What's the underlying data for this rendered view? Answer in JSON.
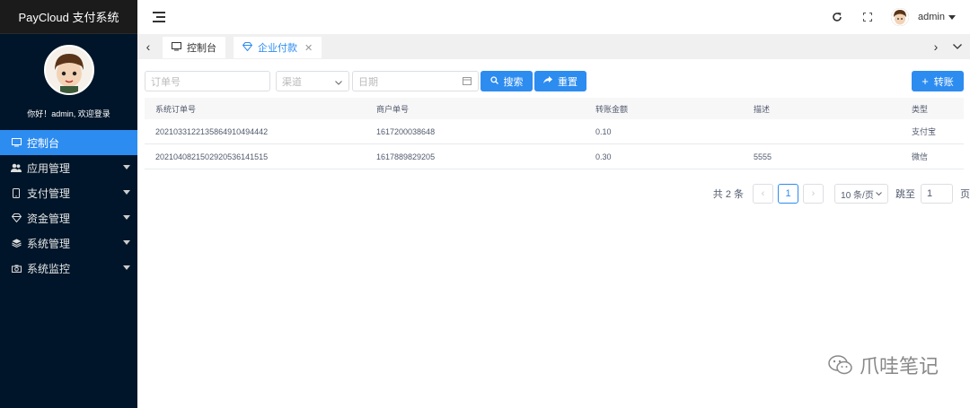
{
  "app": {
    "brand": "PayCloud 支付系统",
    "welcome": "你好！admin, 欢迎登录"
  },
  "sidebar": {
    "items": [
      {
        "label": "控制台",
        "icon": "monitor-icon",
        "active": true,
        "has_caret": false
      },
      {
        "label": "应用管理",
        "icon": "users-icon",
        "active": false,
        "has_caret": true
      },
      {
        "label": "支付管理",
        "icon": "mobile-icon",
        "active": false,
        "has_caret": true
      },
      {
        "label": "资金管理",
        "icon": "diamond-icon",
        "active": false,
        "has_caret": true
      },
      {
        "label": "系统管理",
        "icon": "layers-icon",
        "active": false,
        "has_caret": true
      },
      {
        "label": "系统监控",
        "icon": "camera-icon",
        "active": false,
        "has_caret": true
      }
    ]
  },
  "header": {
    "username": "admin"
  },
  "tabs": [
    {
      "label": "控制台",
      "icon": "monitor-icon",
      "active": false,
      "closable": false
    },
    {
      "label": "企业付款",
      "icon": "diamond-icon",
      "active": true,
      "closable": true
    }
  ],
  "search": {
    "order_no_placeholder": "订单号",
    "channel_placeholder": "渠道",
    "date_placeholder": "日期",
    "search_label": "搜索",
    "reset_label": "重置",
    "transfer_label": "转账"
  },
  "table": {
    "columns": [
      "系统订单号",
      "商户单号",
      "转账金额",
      "描述",
      "类型"
    ],
    "rows": [
      [
        "2021033122135864910494442",
        "1617200038648",
        "0.10",
        "",
        "支付宝"
      ],
      [
        "2021040821502920536141515",
        "1617889829205",
        "0.30",
        "5555",
        "微信"
      ]
    ]
  },
  "pagination": {
    "total": "共 2 条",
    "current": "1",
    "page_size": "10 条/页",
    "goto_label": "跳至",
    "goto_value": "1",
    "page_suffix": "页"
  },
  "watermark": "爪哇笔记",
  "colors": {
    "primary": "#2d8cf0",
    "sidebar_bg": "#001529"
  }
}
